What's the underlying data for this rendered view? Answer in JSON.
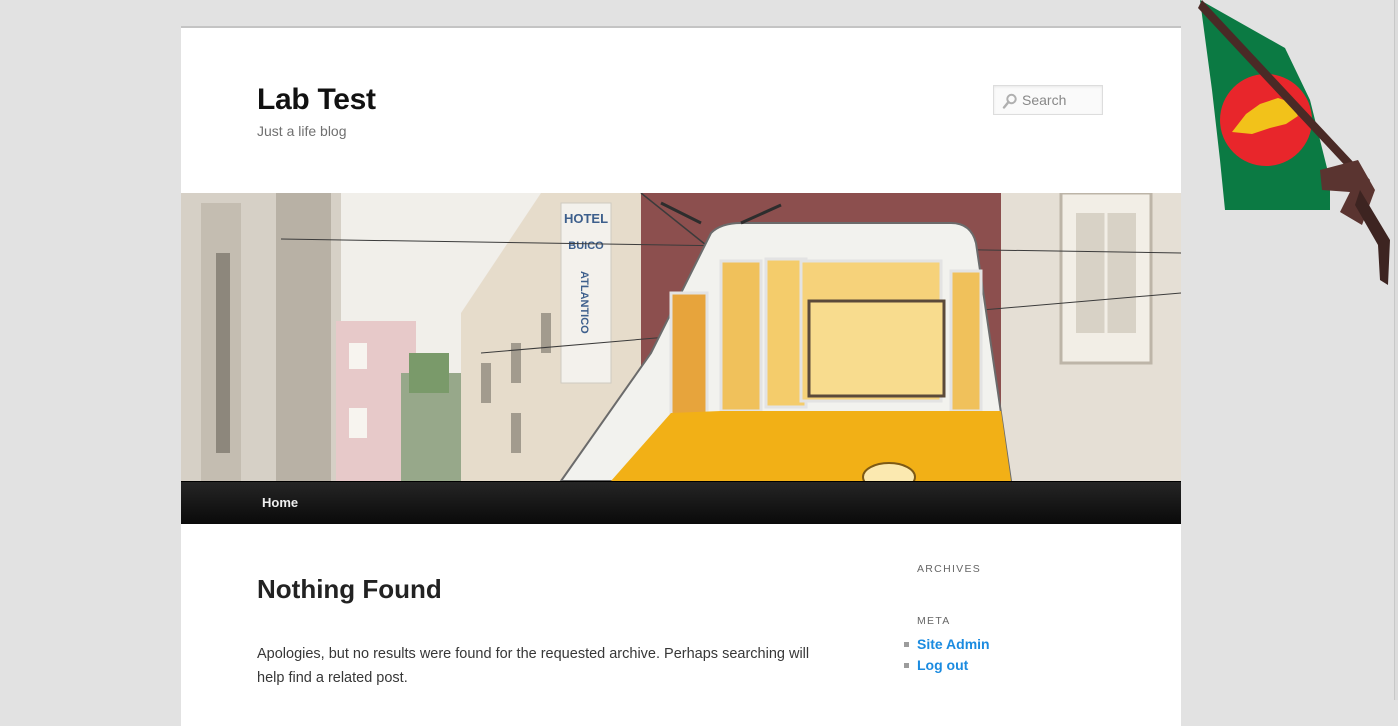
{
  "site": {
    "title": "Lab Test",
    "tagline": "Just a life blog"
  },
  "search": {
    "placeholder": "Search",
    "value": ""
  },
  "header_image": {
    "alt": "Yellow tram in a Lisbon street",
    "sign_lines": [
      "HOTEL",
      "BUICO",
      "ATLANTICO"
    ]
  },
  "nav": {
    "items": [
      {
        "label": "Home"
      }
    ]
  },
  "content": {
    "title": "Nothing Found",
    "body": "Apologies, but no results were found for the requested archive. Perhaps searching will help find a related post."
  },
  "sidebar": {
    "archives_title": "Archives",
    "meta_title": "Meta",
    "meta_links": [
      {
        "label": "Site Admin"
      },
      {
        "label": "Log out"
      }
    ]
  },
  "colors": {
    "background": "#e2e2e2",
    "page": "#ffffff",
    "nav_bar": "#111111",
    "link": "#1b8be0",
    "tram_yellow": "#f2b016",
    "flag_green": "#0b7a43",
    "flag_red": "#e8262b"
  },
  "icons": {
    "search": "magnifier-icon",
    "bullet": "square-bullet-icon"
  }
}
